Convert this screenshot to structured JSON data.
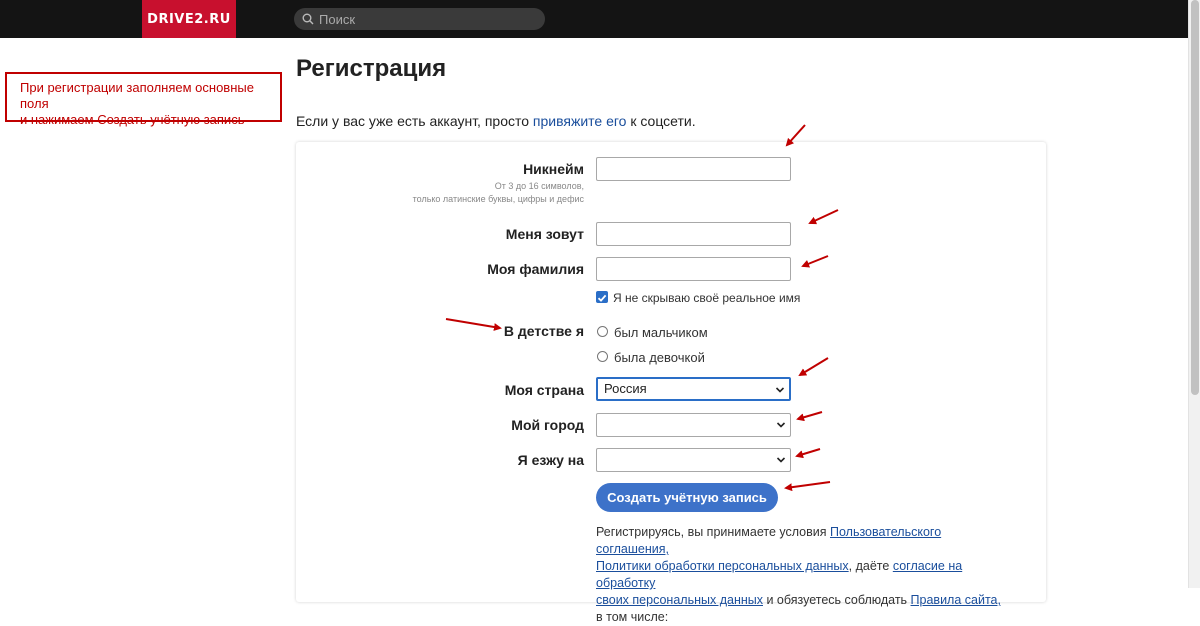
{
  "header": {
    "logo": "DRIVE2.RU",
    "search_placeholder": "Поиск"
  },
  "note": {
    "line1": "При регистрации заполняем основные поля",
    "line2": "и нажимаем Создать учётную запись"
  },
  "page": {
    "title": "Регистрация",
    "intro_before": "Если у вас уже есть аккаунт, просто ",
    "intro_link": "привяжите его",
    "intro_after": " к соцсети."
  },
  "form": {
    "nickname_label": "Никнейм",
    "nickname_hint1": "От 3 до 16 символов,",
    "nickname_hint2": "только латинские буквы, цифры и дефис",
    "nickname_value": "",
    "firstname_label": "Меня зовут",
    "firstname_value": "",
    "lastname_label": "Моя фамилия",
    "lastname_value": "",
    "hide_name_label": "Я не скрываю своё реальное имя",
    "hide_name_checked": true,
    "gender_label": "В детстве я",
    "gender_options": [
      "был мальчиком",
      "была девочкой"
    ],
    "country_label": "Моя страна",
    "country_value": "Россия",
    "city_label": "Мой город",
    "city_value": "",
    "car_label": "Я езжу на",
    "car_value": "",
    "submit_label": "Создать учётную запись"
  },
  "terms": {
    "t1": "Регистрируясь, вы принимаете условия ",
    "l1": "Пользовательского соглашения,",
    "l2": "Политики обработки персональных данных",
    "t2": ", даёте ",
    "l3": "согласие на обработку",
    "l4": "своих персональных данных",
    "t3": " и обязуетесь соблюдать ",
    "l5": "Правила сайта,",
    "t4": "в том числе:"
  },
  "colors": {
    "logo_bg": "#c8102e",
    "topbar_bg": "#141414",
    "accent": "#3d72c9",
    "link": "#1a4e9c",
    "annotation": "#c00000"
  }
}
